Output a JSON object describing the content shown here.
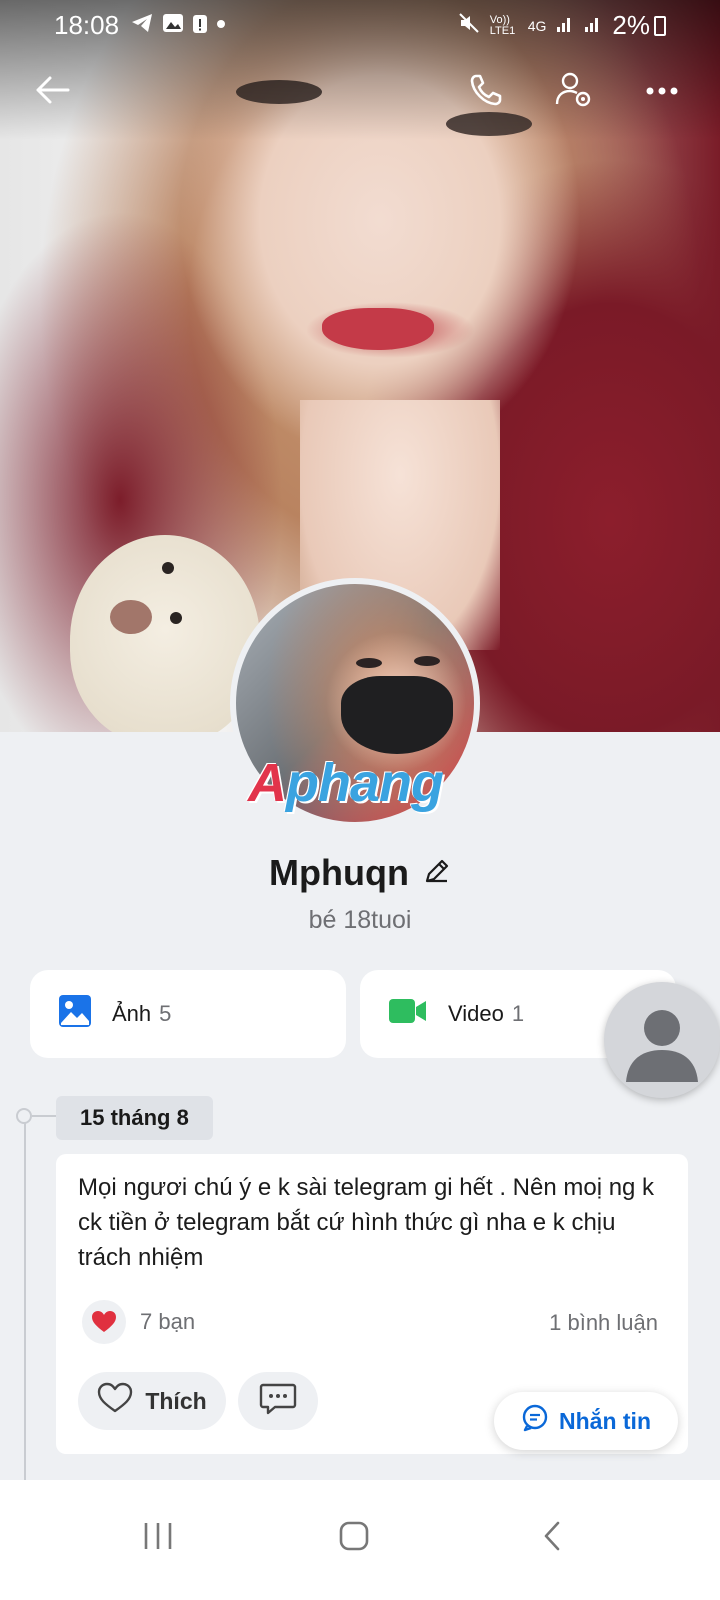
{
  "status_bar": {
    "time": "18:08",
    "network_label": "4G",
    "volte_label": "Vo)) LTE1",
    "battery": "2%"
  },
  "top_bar": {
    "back_icon": "arrow-left-icon",
    "call_icon": "phone-icon",
    "settings_icon": "user-settings-icon",
    "more_icon": "more-horizontal-icon"
  },
  "profile": {
    "watermark": "Aphang",
    "name": "Mphuqn",
    "bio": "bé 18tuoi"
  },
  "media": {
    "photos_label": "Ảnh",
    "photos_count": "5",
    "videos_label": "Video",
    "videos_count": "1"
  },
  "timeline": {
    "date": "15 tháng 8",
    "post": {
      "text": "Mọi ngươi chú ý e k sài telegram gi hết . Nên moị ng k ck tiền ở telegram bắt cứ hình thức gì nha e k chịu trách nhiệm",
      "reactions": "7 bạn",
      "comments": "1 bình luận",
      "like_label": "Thích"
    }
  },
  "actions": {
    "message_label": "Nhắn tin"
  },
  "colors": {
    "accent": "#0a68d8",
    "photo_icon": "#1a73e8",
    "video_icon": "#2ebd5f",
    "heart": "#e0303f"
  }
}
